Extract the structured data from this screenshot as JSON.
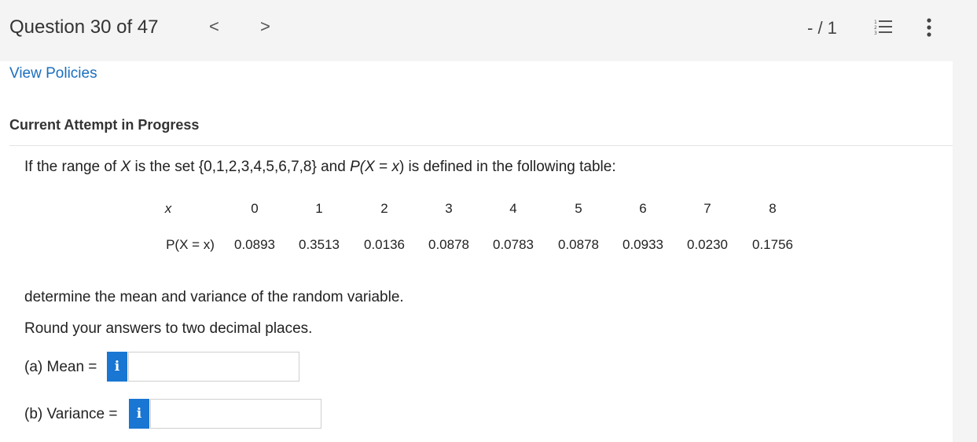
{
  "header": {
    "question_label": "Question 30 of 47",
    "prev_label": "<",
    "next_label": ">",
    "score": "- / 1"
  },
  "card": {
    "policies_link": "View Policies",
    "attempt_heading": "Current Attempt in Progress",
    "question_parts": {
      "p1": "If the range of ",
      "var": "X",
      "p2": " is the set {0,1,2,3,4,5,6,7,8} and ",
      "p3": "P(",
      "p4": "X",
      "p5": " = ",
      "p6": "x",
      "p7": ") is defined in the following table:"
    },
    "table": {
      "x_header": "x",
      "p_header": "P(X = x)",
      "x_values": [
        "0",
        "1",
        "2",
        "3",
        "4",
        "5",
        "6",
        "7",
        "8"
      ],
      "p_values": [
        "0.0893",
        "0.3513",
        "0.0136",
        "0.0878",
        "0.0783",
        "0.0878",
        "0.0933",
        "0.0230",
        "0.1756"
      ]
    },
    "prompt1": "determine the mean and variance of the random variable.",
    "prompt2": "Round your answers to two decimal places.",
    "answers": {
      "mean_label": "(a) Mean =",
      "variance_label": "(b) Variance =",
      "info_glyph": "i",
      "mean_value": "",
      "variance_value": ""
    }
  },
  "colors": {
    "accent": "#1976d2",
    "link": "#1a6fbf",
    "background": "#f4f4f4"
  },
  "icons": [
    "chevron-left-icon",
    "chevron-right-icon",
    "numbered-list-icon",
    "more-vertical-icon",
    "info-icon"
  ]
}
